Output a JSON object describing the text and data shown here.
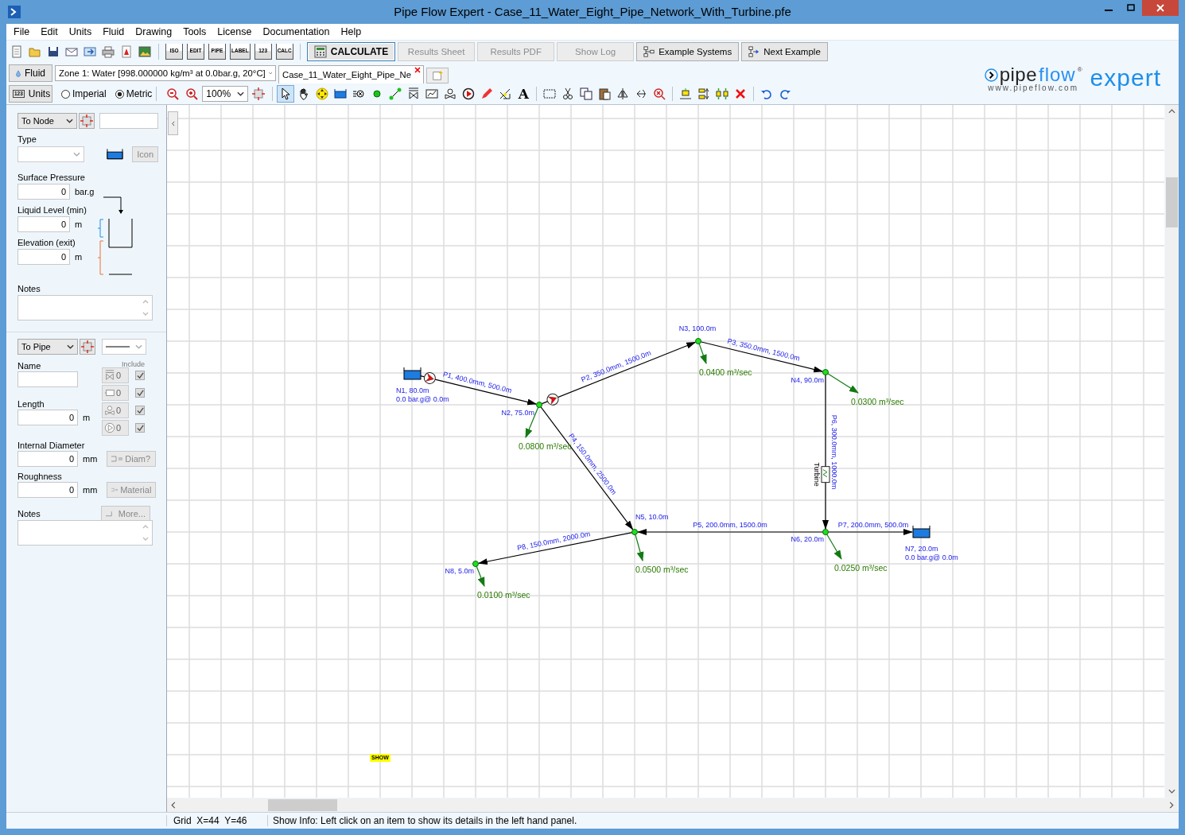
{
  "window": {
    "title": "Pipe Flow Expert - Case_11_Water_Eight_Pipe_Network_With_Turbine.pfe"
  },
  "menu": [
    "File",
    "Edit",
    "Units",
    "Fluid",
    "Drawing",
    "Tools",
    "License",
    "Documentation",
    "Help"
  ],
  "file_tools": [
    {
      "kind": "new"
    },
    {
      "kind": "open"
    },
    {
      "kind": "save"
    },
    {
      "kind": "email"
    },
    {
      "kind": "export"
    },
    {
      "kind": "print"
    },
    {
      "kind": "pdf"
    },
    {
      "kind": "image"
    }
  ],
  "view_tools": [
    "ISO",
    "EDIT",
    "PIPE",
    "LABEL",
    "123",
    "CALC"
  ],
  "actions": [
    {
      "kind": "calculate",
      "label": "CALCULATE",
      "disabled": false
    },
    {
      "kind": "plain",
      "label": "Results Sheet",
      "disabled": true
    },
    {
      "kind": "plain",
      "label": "Results PDF",
      "disabled": true
    },
    {
      "kind": "plain",
      "label": "Show Log",
      "disabled": true
    },
    {
      "kind": "systems",
      "label": "Example Systems",
      "disabled": false
    },
    {
      "kind": "next",
      "label": "Next Example",
      "disabled": false
    }
  ],
  "fluid": {
    "button": "Fluid",
    "value": "Zone 1: Water [998.000000 kg/m³ at 0.0bar.g, 20°C]"
  },
  "tabs": [
    {
      "label": "Case_11_Water_Eight_Pipe_Ne",
      "selected": true
    }
  ],
  "units": {
    "button": "Units",
    "icon_text": "123",
    "options": [
      {
        "label": "Imperial",
        "selected": false
      },
      {
        "label": "Metric",
        "selected": true
      }
    ]
  },
  "zoom": "100%",
  "drawing_tools": [
    {
      "kind": "pointer",
      "selected": true
    },
    {
      "kind": "hand",
      "selected": false
    },
    {
      "kind": "move",
      "selected": false
    },
    {
      "kind": "tank",
      "selected": false
    },
    {
      "kind": "fan",
      "selected": false
    },
    {
      "kind": "node",
      "selected": false
    },
    {
      "kind": "pipe",
      "selected": false
    },
    {
      "kind": "valve",
      "selected": false
    },
    {
      "kind": "graph",
      "selected": false
    },
    {
      "kind": "fitting",
      "selected": false
    },
    {
      "kind": "pump",
      "selected": false
    },
    {
      "kind": "pencil",
      "selected": false
    },
    {
      "kind": "cross",
      "selected": false
    },
    {
      "kind": "text",
      "label": "A",
      "selected": false
    },
    {
      "kind": "gap"
    },
    {
      "kind": "select",
      "selected": false
    },
    {
      "kind": "cut",
      "selected": false
    },
    {
      "kind": "copy",
      "selected": false
    },
    {
      "kind": "paste",
      "selected": false
    },
    {
      "kind": "flip",
      "selected": false
    },
    {
      "kind": "rotate",
      "selected": false
    },
    {
      "kind": "find",
      "selected": false
    },
    {
      "kind": "gap"
    },
    {
      "kind": "align",
      "selected": false
    },
    {
      "kind": "spread",
      "selected": false
    },
    {
      "kind": "columns",
      "selected": false
    },
    {
      "kind": "delete",
      "selected": false
    },
    {
      "kind": "gap"
    },
    {
      "kind": "undo",
      "selected": false
    },
    {
      "kind": "redo",
      "selected": false
    }
  ],
  "logo": {
    "pipe": "pipe",
    "flow": "flow",
    "mark": "®",
    "expert": "expert",
    "url": "www.pipeflow.com"
  },
  "node_panel": {
    "selector": "To Node",
    "type_label": "Type",
    "icon_button": {
      "label": "Icon",
      "disabled": true
    },
    "fields": [
      {
        "label": "Surface Pressure",
        "value": "0",
        "unit": "bar.g"
      },
      {
        "label": "Liquid Level (min)",
        "value": "0",
        "unit": "m"
      },
      {
        "label": "Elevation (exit)",
        "value": "0",
        "unit": "m"
      }
    ],
    "notes_label": "Notes"
  },
  "pipe_panel": {
    "selector": "To Pipe",
    "name_label": "Name",
    "include_label": "Include",
    "fittings": [
      {
        "kind": "valve",
        "count": "0",
        "checked": true
      },
      {
        "kind": "fitting",
        "count": "0",
        "checked": true
      },
      {
        "kind": "control",
        "count": "0",
        "checked": true
      },
      {
        "kind": "pump",
        "count": "0",
        "checked": true
      }
    ],
    "length": {
      "label": "Length",
      "value": "0",
      "unit": "m"
    },
    "diameter": {
      "label": "Internal Diameter",
      "value": "0",
      "unit": "mm",
      "button": "Diam?",
      "disabled": true
    },
    "roughness": {
      "label": "Roughness",
      "value": "0",
      "unit": "mm",
      "button": "Material",
      "disabled": true
    },
    "more_button": {
      "label": "More...",
      "disabled": true
    },
    "notes_label": "Notes"
  },
  "diagram": {
    "nodes": [
      {
        "kind": "tank",
        "label": "N1, 80.0m",
        "pressure": "0.0 bar.g@ 0.0m"
      },
      {
        "kind": "junction",
        "label": "N2, 75.0m",
        "demand": "0.0800 m³/sec"
      },
      {
        "kind": "junction",
        "label": "N3, 100.0m",
        "demand": "0.0400 m³/sec"
      },
      {
        "kind": "junction",
        "label": "N4, 90.0m",
        "demand": "0.0300 m³/sec"
      },
      {
        "kind": "junction",
        "label": "N5, 10.0m",
        "demand": "0.0500 m³/sec"
      },
      {
        "kind": "junction",
        "label": "N6, 20.0m",
        "demand": "0.0250 m³/sec"
      },
      {
        "kind": "tank",
        "label": "N7, 20.0m",
        "pressure": "0.0 bar.g@ 0.0m"
      },
      {
        "kind": "junction",
        "label": "N8, 5.0m",
        "demand": "0.0100 m³/sec"
      }
    ],
    "pipes": [
      {
        "label": "P1, 400.0mm, 500.0m",
        "kind": "pump"
      },
      {
        "label": "P2, 350.0mm, 1500.0m",
        "kind": "pump"
      },
      {
        "label": "P3, 350.0mm, 1500.0m",
        "kind": "plain"
      },
      {
        "label": "P4, 150.0mm, 2500.0m",
        "kind": "plain"
      },
      {
        "label": "P5, 200.0mm, 1500.0m",
        "kind": "plain"
      },
      {
        "label": "P6, 300.0mm, 1000.0m",
        "kind": "turbine",
        "component_label": "Turbine"
      },
      {
        "label": "P7, 200.0mm, 500.0m",
        "kind": "plain"
      },
      {
        "label": "P8, 150.0mm, 2000.0m",
        "kind": "plain"
      }
    ],
    "tag": "SHOW"
  },
  "status_bar": {
    "grid": "Grid  X=44  Y=46",
    "info": "Show Info: Left click on an item to show its details in the left hand panel."
  }
}
